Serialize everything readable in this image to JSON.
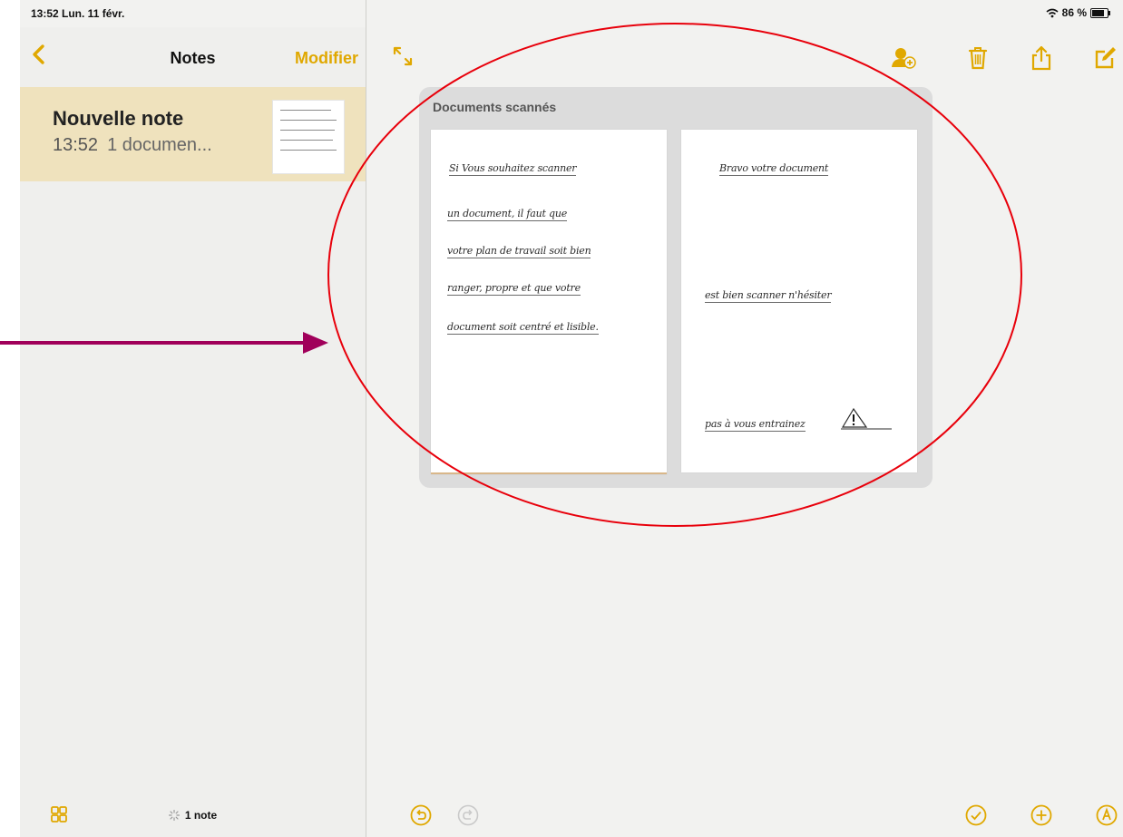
{
  "status_bar": {
    "time": "13:52  Lun. 11 févr.",
    "battery": "86 %"
  },
  "sidebar": {
    "title": "Notes",
    "edit_label": "Modifier",
    "note": {
      "title": "Nouvelle note",
      "time": "13:52",
      "preview": "1 documen..."
    },
    "footer_count": "1 note"
  },
  "main": {
    "scanned_title": "Documents scannés",
    "page1_lines": [
      "Si Vous souhaitez scanner",
      "un document, il faut que",
      "votre plan de travail soit bien",
      "ranger, propre et que votre",
      "document soit centré et lisible."
    ],
    "page2_lines": [
      "Bravo votre document",
      "est bien scanner n'hésiter",
      "pas à vous entrainez"
    ]
  },
  "icons": {
    "back": "chevron-left-icon",
    "expand": "expand-icon",
    "add_people": "add-people-icon",
    "trash": "trash-icon",
    "share": "share-icon",
    "compose": "compose-icon",
    "undo": "undo-icon",
    "redo": "redo-icon",
    "checklist": "checklist-icon",
    "add": "add-icon",
    "markup": "markup-icon",
    "grid": "grid-icon"
  },
  "colors": {
    "accent": "#e0a800",
    "annotation": "#e8000b",
    "arrow": "#a0005a",
    "selected_row": "#efe2bd"
  }
}
